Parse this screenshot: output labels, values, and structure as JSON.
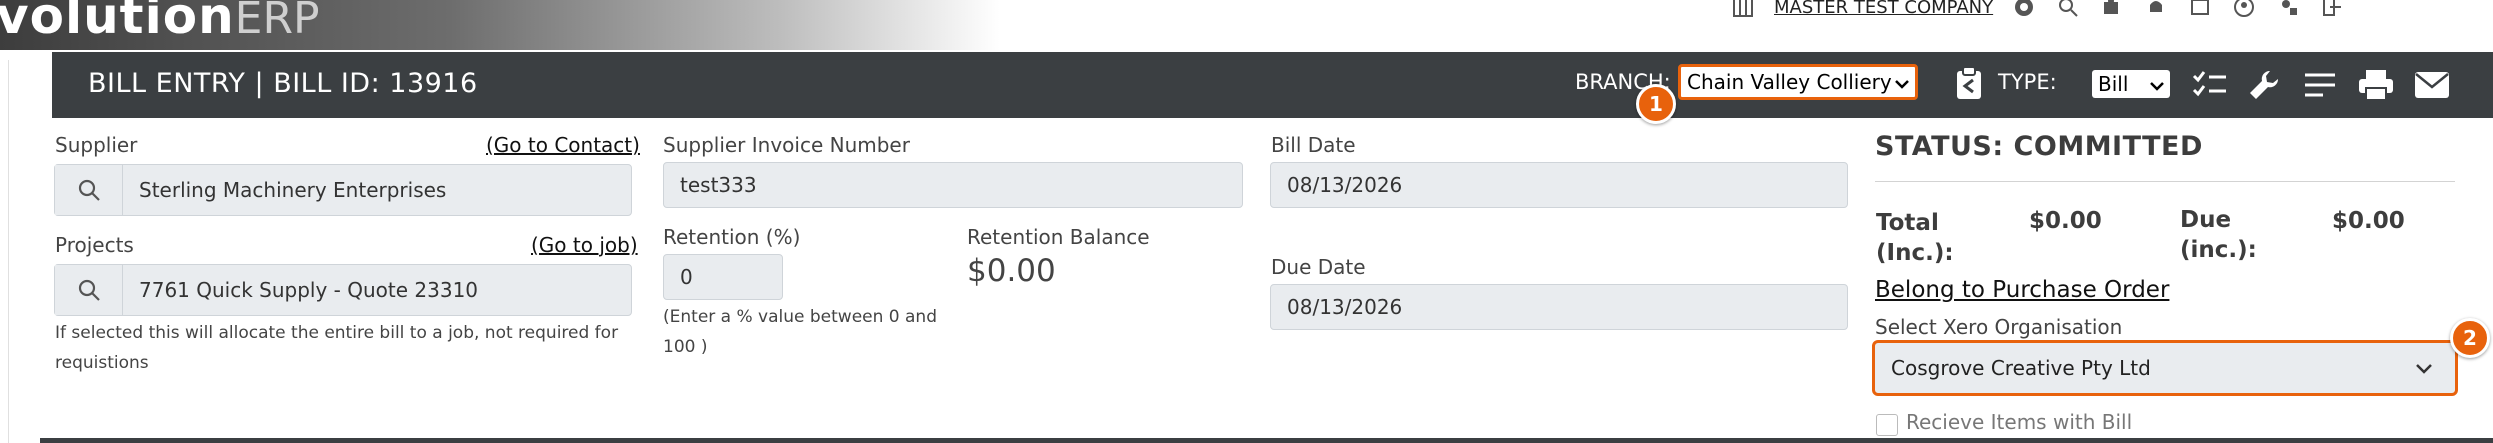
{
  "app": {
    "logo_main": "volution",
    "logo_suffix": "ERP"
  },
  "topbar": {
    "company": "MASTER TEST COMPANY"
  },
  "header": {
    "title": "BILL ENTRY | BILL ID: 13916",
    "branch_label": "BRANCH:",
    "branch_value": "Chain Valley Colliery",
    "type_label": "TYPE:",
    "type_value": "Bill"
  },
  "badges": {
    "one": "1",
    "two": "2"
  },
  "supplier": {
    "label": "Supplier",
    "link": "(Go to Contact)",
    "value": "Sterling Machinery Enterprises"
  },
  "projects": {
    "label": "Projects",
    "link": "(Go to job)",
    "value": "7761 Quick Supply - Quote 23310",
    "help": "If selected this will allocate the entire bill to a job, not required for requistions"
  },
  "invoice": {
    "label": "Supplier Invoice Number",
    "value": "test333"
  },
  "retention": {
    "label": "Retention (%)",
    "value": "0",
    "help": "(Enter a % value between 0 and 100 )",
    "balance_label": "Retention Balance",
    "balance_value": "$0.00"
  },
  "bill_date": {
    "label": "Bill Date",
    "value": "08/13/2026"
  },
  "due_date": {
    "label": "Due Date",
    "value": "08/13/2026"
  },
  "status": {
    "text": "STATUS: COMMITTED",
    "total_label": "Total (Inc.):",
    "total_value": "$0.00",
    "due_label": "Due (inc.):",
    "due_value": "$0.00",
    "belong_link": "Belong to Purchase Order",
    "xero_label": "Select Xero Organisation",
    "xero_value": "Cosgrove Creative Pty Ltd",
    "receive_label": "Recieve Items with Bill"
  },
  "colors": {
    "header_bg": "#3b3f42",
    "accent": "#e8620c",
    "field_bg": "#e9ecef"
  }
}
